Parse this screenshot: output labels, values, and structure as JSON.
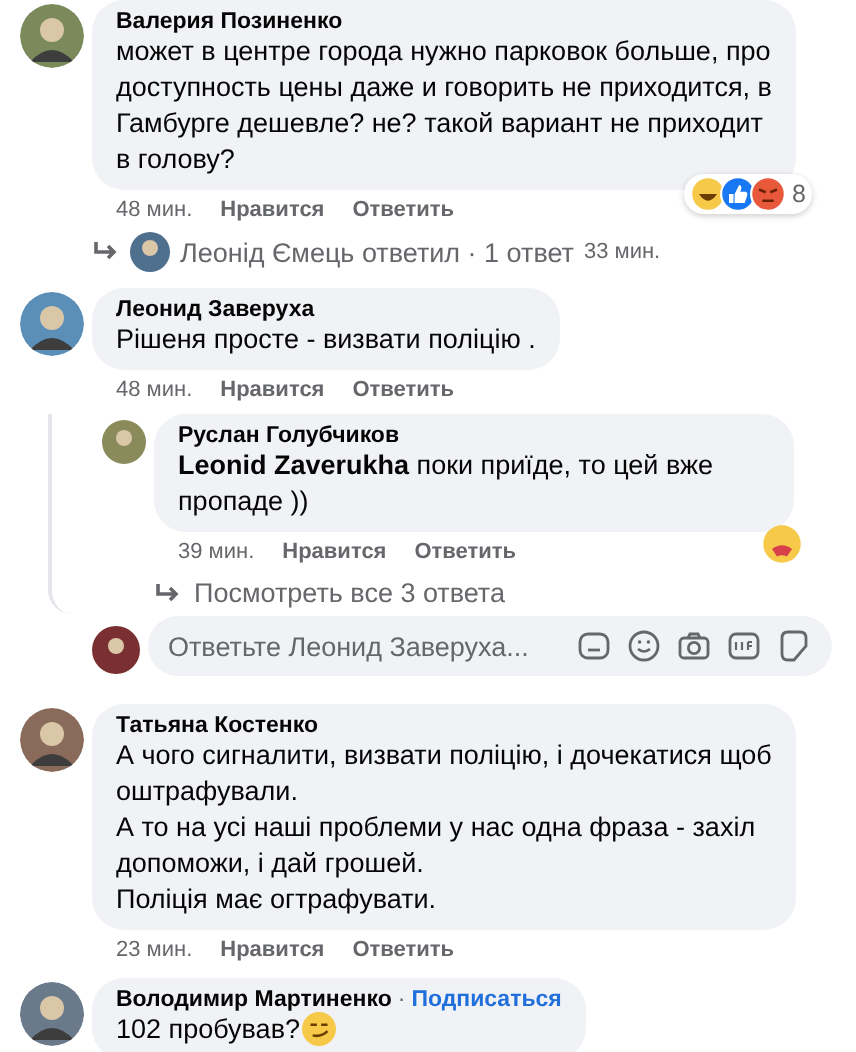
{
  "comments": [
    {
      "author": "Валерия Позиненко",
      "text": "может в центре города нужно парковок больше, про доступность цены даже и говорить не приходится, в Гамбурге дешевле? не? такой вариант не приходит в голову?",
      "time": "48 мин.",
      "like": "Нравится",
      "reply": "Ответить",
      "reactions": [
        {
          "kind": "haha"
        },
        {
          "kind": "like"
        },
        {
          "kind": "angry"
        }
      ],
      "reaction_count": "8",
      "reply_summary": {
        "text": "Леонід Ємець ответил · 1 ответ",
        "time": "33 мин."
      }
    },
    {
      "author": "Леонид Заверуха",
      "text": "Рішеня просте - визвати поліцію .",
      "time": "48 мин.",
      "like": "Нравится",
      "reply": "Ответить",
      "replies": [
        {
          "author": "Руслан Голубчиков",
          "text": "**Leonid Zaverukha** поки приїде, то цей вже пропаде ))",
          "time": "39 мин.",
          "like": "Нравится",
          "reply": "Ответить",
          "reactions": [
            {
              "kind": "care"
            }
          ]
        }
      ],
      "view_more": "Посмотреть все 3 ответа",
      "reply_box": {
        "placeholder": "Ответьте Леонид Заверуха..."
      }
    },
    {
      "author": "Татьяна Костенко",
      "text": "А чого сигналити, визвати поліцію, і дочекатися щоб оштрафували.\nА то на усі наші проблеми у нас одна фраза - захіл допоможи, і дай грошей.\nПоліція має огтрафувати.",
      "time": "23 мин.",
      "like": "Нравится",
      "reply": "Ответить"
    },
    {
      "author": "Володимир Мартиненко",
      "separator": "·",
      "follow": "Подписаться",
      "text": "102 пробував?",
      "trailing_emoji": {
        "kind": "smirk"
      }
    }
  ]
}
